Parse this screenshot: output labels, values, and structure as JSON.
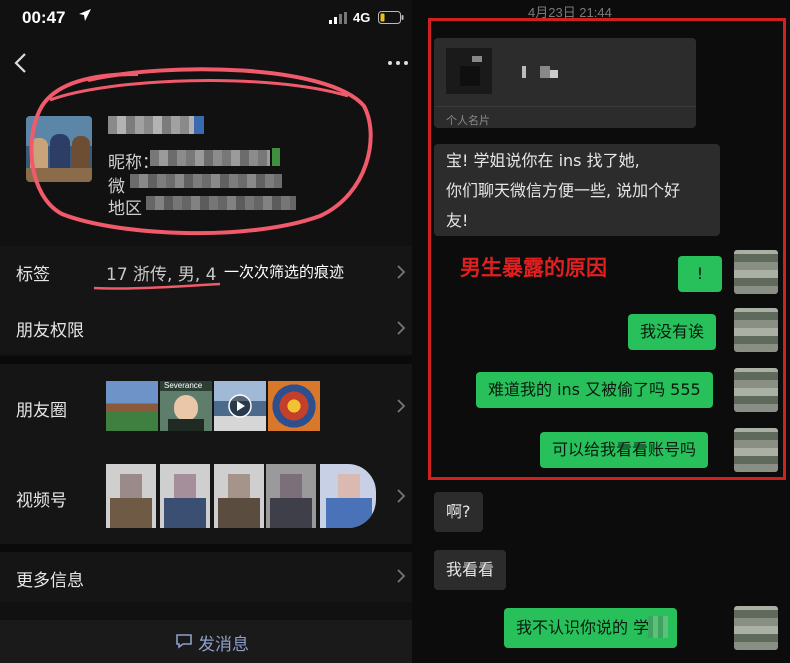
{
  "status": {
    "time": "00:47",
    "network": "4G"
  },
  "profile": {
    "nickname_label": "昵称：",
    "wechat_label": "微",
    "region_label": "地区"
  },
  "rows": {
    "tags_label": "标签",
    "tags_values": "17 浙传, 男, 4",
    "tags_annotation": "一次次筛选的痕迹",
    "friend_permissions": "朋友权限",
    "moments": "朋友圈",
    "moments_thumb_text": "Severance",
    "channels": "视频号",
    "more_info": "更多信息"
  },
  "send_message": "发消息",
  "chat": {
    "timestamp": "4月23日 21:44",
    "card_label": "个人名片",
    "headline": "男生暴露的原因",
    "messages": [
      {
        "dir": "in",
        "text": "宝!       学姐说你在 ins 找了她,\n你们聊天微信方便一些, 说加个好\n友!"
      },
      {
        "dir": "out",
        "text": "!"
      },
      {
        "dir": "out",
        "text": "我没有诶"
      },
      {
        "dir": "out",
        "text": "难道我的 ins 又被偷了吗 555"
      },
      {
        "dir": "out",
        "text": "可以给我看看账号吗"
      },
      {
        "dir": "in",
        "text": "啊?"
      },
      {
        "dir": "in",
        "text": "我看看"
      },
      {
        "dir": "out",
        "text": "我不认识你说的        学姐"
      }
    ]
  },
  "colors": {
    "accent_red": "#d21f1f",
    "bubble_green": "#27c05a",
    "link_blue": "#8ea0c8"
  },
  "icons": [
    "location-arrow-icon",
    "signal-icon",
    "battery-icon",
    "back-chevron-icon",
    "more-dots-icon",
    "chevron-right-icon",
    "chat-bubble-icon",
    "play-icon"
  ]
}
